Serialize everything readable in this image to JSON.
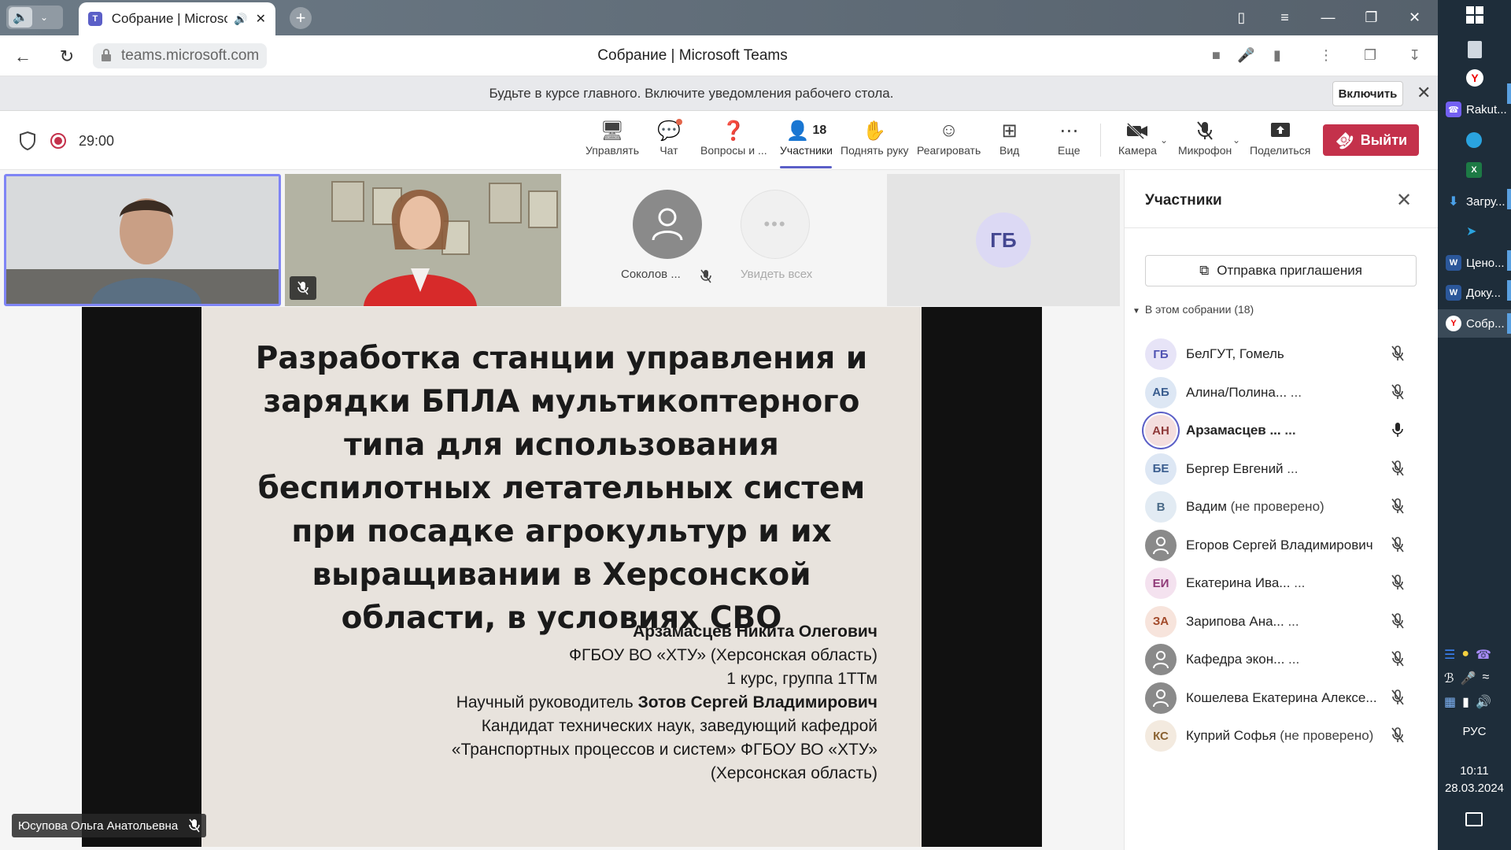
{
  "browser": {
    "tab_title": "Собрание | Microsoft Teams",
    "url": "teams.microsoft.com",
    "page_title": "Собрание | Microsoft Teams"
  },
  "notification": {
    "text": "Будьте в курсе главного. Включите уведомления рабочего стола.",
    "button": "Включить"
  },
  "meeting": {
    "timer": "29:00",
    "participant_count": "18",
    "toolbar": {
      "manage": "Управлять",
      "chat": "Чат",
      "qa": "Вопросы и ...",
      "people": "Участники",
      "raise_hand": "Поднять руку",
      "react": "Реагировать",
      "view": "Вид",
      "more": "Еще",
      "camera": "Камера",
      "mic": "Микрофон",
      "share": "Поделиться",
      "leave": "Выйти"
    }
  },
  "stage": {
    "tile_sokolov": "Соколов ...",
    "tile_seeall": "Увидеть всех",
    "tile_gb": "ГБ",
    "presenter": "Юсупова Ольга Анатольевна"
  },
  "slide": {
    "title": "Разработка станции управления и зарядки БПЛА мультикоптерного типа для использования беспилотных летательных систем при посадке агрокультур и их выращивании в Херсонской области, в условиях СВО",
    "author": "Арзамасцев Никита Олегович",
    "org": "ФГБОУ ВО «ХТУ» (Херсонская область)",
    "group": "1 курс, группа 1ТТм",
    "advisor_label": "Научный руководитель ",
    "advisor_name": "Зотов Сергей Владимирович",
    "advisor_title_1": "Кандидат технических наук, заведующий кафедрой",
    "advisor_title_2": "«Транспортных процессов и систем» ФГБОУ ВО «ХТУ»",
    "advisor_title_3": "(Херсонская область)"
  },
  "panel": {
    "title": "Участники",
    "invite": "Отправка приглашения",
    "section": "В этом собрании (18)",
    "participants": [
      {
        "initials": "ГБ",
        "name": "БелГУТ, Гомель",
        "sub": "",
        "bg": "#e7e4f7",
        "fg": "#4f52b2"
      },
      {
        "initials": "АБ",
        "name": "Алина/Полина...",
        "sub": "...",
        "bg": "#dde7f4",
        "fg": "#3a5d8f"
      },
      {
        "initials": "АН",
        "name": "Арзамасцев ...",
        "sub": "...",
        "bg": "#f4dede",
        "fg": "#8f3a3a"
      },
      {
        "initials": "БЕ",
        "name": "Бергер Евгений",
        "sub": "...",
        "bg": "#dde7f4",
        "fg": "#3a5d8f"
      },
      {
        "initials": "В",
        "name": "Вадим",
        "sub": "(не проверено)",
        "bg": "#e2ebf3",
        "fg": "#4a6a87"
      },
      {
        "initials": "",
        "name": "Егоров Сергей Владимирович",
        "sub": "",
        "bg": "#8a8a8a",
        "fg": "#fff"
      },
      {
        "initials": "ЕИ",
        "name": "Екатерина Ива...",
        "sub": "...",
        "bg": "#f4e2ef",
        "fg": "#8f3a77"
      },
      {
        "initials": "ЗА",
        "name": "Зарипова Ана...",
        "sub": "...",
        "bg": "#f7e4dc",
        "fg": "#a24a2a"
      },
      {
        "initials": "",
        "name": "Кафедра экон...",
        "sub": "...",
        "bg": "#8a8a8a",
        "fg": "#fff"
      },
      {
        "initials": "",
        "name": "Кошелева Екатерина Алексе...",
        "sub": "",
        "bg": "#8a8a8a",
        "fg": "#fff"
      },
      {
        "initials": "КС",
        "name": "Куприй Софья",
        "sub": "(не проверено)",
        "bg": "#f3eadf",
        "fg": "#8a6232"
      }
    ]
  },
  "taskbar": {
    "items": [
      "Rakut...",
      "Загру...",
      "Ценo...",
      "Доку...",
      "Собр..."
    ],
    "lang": "РУС",
    "time": "10:11",
    "date": "28.03.2024"
  }
}
